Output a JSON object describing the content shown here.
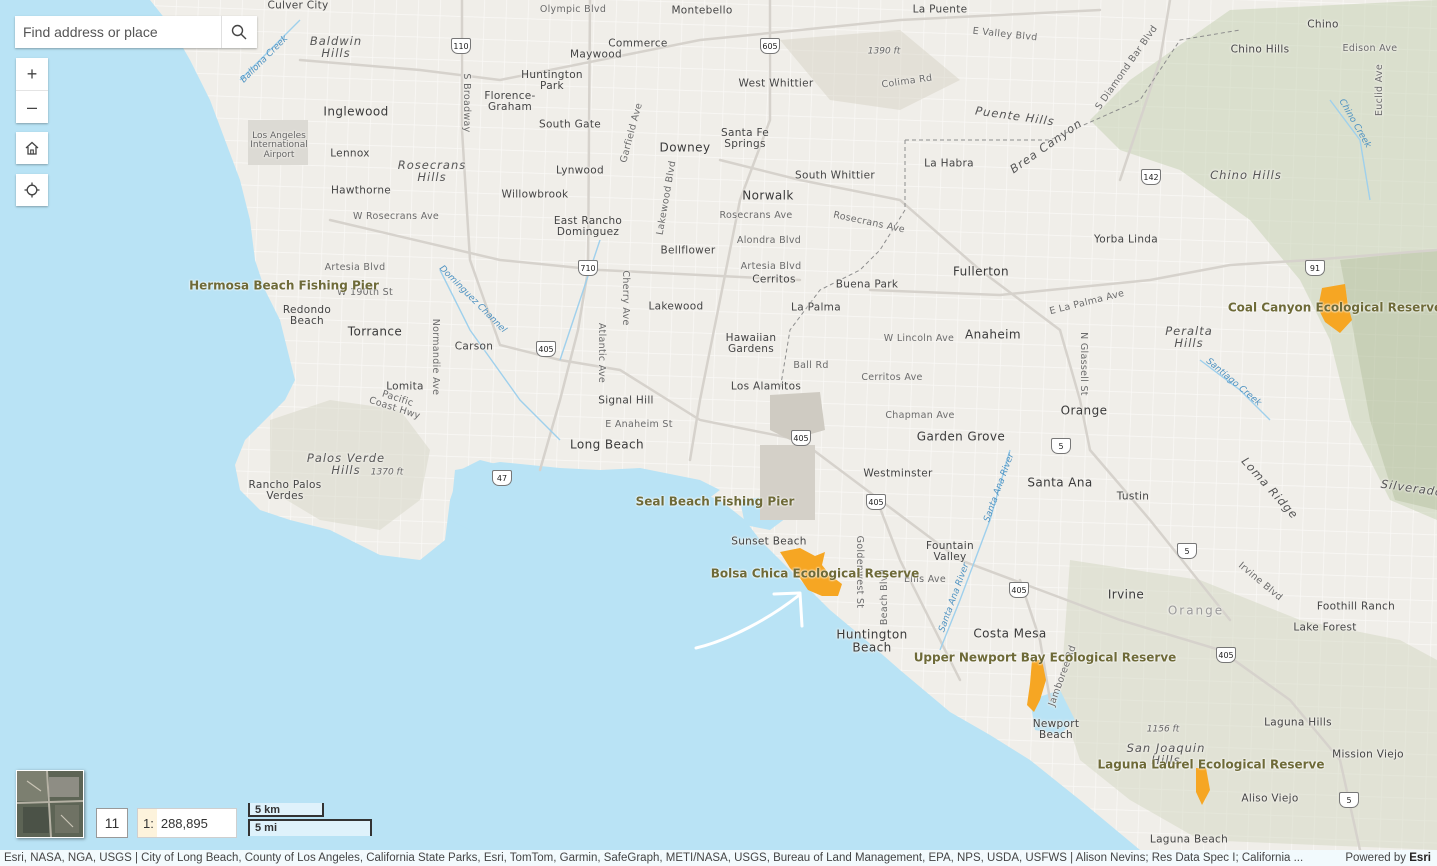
{
  "search": {
    "placeholder": "Find address or place"
  },
  "zoom": {
    "in_label": "+",
    "out_label": "–"
  },
  "zoom_level": "11",
  "scale": {
    "prefix": "1:",
    "value": "288,895"
  },
  "scalebar": {
    "metric": "5 km",
    "imperial": "5 mi"
  },
  "attribution": {
    "text": "Esri, NASA, NGA, USGS | City of Long Beach, County of Los Angeles, California State Parks, Esri, TomTom, Garmin, SafeGraph, METI/NASA, USGS, Bureau of Land Management, EPA, NPS, USDA, USFWS | Alison Nevins; Res Data Spec I; California ...",
    "powered_by": "Powered by",
    "powered_brand": "Esri"
  },
  "colors": {
    "water": "#b9e3f5",
    "land": "#f0eee9",
    "reserve": "#f6a623",
    "poi_text": "#6e6a38"
  },
  "poi": {
    "hermosa": "Hermosa Beach Fishing Pier",
    "seal": "Seal Beach Fishing Pier",
    "bolsa": "Bolsa Chica Ecological Reserve",
    "coal": "Coal Canyon Ecological Reserve",
    "newport": "Upper Newport Bay Ecological Reserve",
    "laguna": "Laguna Laurel Ecological Reserve"
  },
  "labels": {
    "culver_city": "Culver City",
    "montebello": "Montebello",
    "la_puente": "La Puente",
    "chino": "Chino",
    "baldwin_hills": "Baldwin\nHills",
    "commerce": "Commerce",
    "maywood": "Maywood",
    "chino_hills": "Chino Hills",
    "huntington_park": "Huntington\nPark",
    "west_whittier": "West Whittier",
    "inglewood": "Inglewood",
    "florence_graham": "Florence-\nGraham",
    "lax": "Los Angeles\nInternational\nAirport",
    "south_gate": "South Gate",
    "santa_fe_springs": "Santa Fe\nSprings",
    "downey": "Downey",
    "lennox": "Lennox",
    "rosecrans_hills": "Rosecrans\nHills",
    "lynwood": "Lynwood",
    "la_habra": "La Habra",
    "south_whittier": "South Whittier",
    "hawthorne": "Hawthorne",
    "willowbrook": "Willowbrook",
    "norwalk": "Norwalk",
    "chino_hills_range": "Chino Hills",
    "east_rancho": "East Rancho\nDominguez",
    "yorba_linda": "Yorba Linda",
    "bellflower": "Bellflower",
    "fullerton": "Fullerton",
    "cerritos": "Cerritos",
    "buena_park": "Buena Park",
    "redondo": "Redondo\nBeach",
    "torrance": "Torrance",
    "carson": "Carson",
    "lakewood": "Lakewood",
    "la_palma": "La Palma",
    "anaheim": "Anaheim",
    "peralta_hills": "Peralta\nHills",
    "hawaiian_gardens": "Hawaiian\nGardens",
    "lomita": "Lomita",
    "los_alamitos": "Los Alamitos",
    "signal_hill": "Signal Hill",
    "orange": "Orange",
    "long_beach": "Long Beach",
    "garden_grove": "Garden Grove",
    "palos_verde_hills": "Palos Verde\nHills",
    "westminster": "Westminster",
    "rancho_palos_verdes": "Rancho Palos\nVerdes",
    "santa_ana": "Santa Ana",
    "tustin": "Tustin",
    "silverado": "Silverado",
    "sunset_beach": "Sunset Beach",
    "fountain_valley": "Fountain\nValley",
    "irvine": "Irvine",
    "foothill_ranch": "Foothill Ranch",
    "orange_county": "Orange",
    "lake_forest": "Lake Forest",
    "huntington_beach": "Huntington\nBeach",
    "costa_mesa": "Costa Mesa",
    "newport_beach": "Newport\nBeach",
    "laguna_hills": "Laguna Hills",
    "san_joaquin_hills": "San Joaquin\nHills",
    "mission_viejo": "Mission Viejo",
    "aliso_viejo": "Aliso Viejo",
    "laguna_beach": "Laguna Beach",
    "loma_ridge": "Loma Ridge",
    "puente_hills": "Puente Hills",
    "brea_canyon": "Brea Canyon",
    "st_e_valley": "E Valley Blvd",
    "st_olympic": "Olympic Blvd",
    "st_colima": "Colima Rd",
    "st_diamond": "S Diamond Bar Blvd",
    "st_edison": "Edison Ave",
    "st_euclid": "Euclid Ave",
    "st_garfield": "Garfield Ave",
    "st_broadway": "S Broadway",
    "st_lakewood": "Lakewood Blvd",
    "st_w_rosecrans": "W Rosecrans Ave",
    "st_rosecrans": "Rosecrans Ave",
    "st_rosecrans2": "Rosecrans Ave",
    "st_alondra": "Alondra Blvd",
    "st_artesia": "Artesia Blvd",
    "st_artesia2": "Artesia Blvd",
    "st_w190": "W 190th St",
    "st_cherry": "Cherry Ave",
    "st_la_palma": "E La Palma Ave",
    "st_normandie": "Normandie Ave",
    "st_atlantic": "Atlantic Ave",
    "st_w_lincoln": "W Lincoln Ave",
    "st_ball": "Ball Rd",
    "st_cerritos": "Cerritos Ave",
    "st_pch": "Pacific\nCoast Hwy",
    "st_chapman": "Chapman Ave",
    "st_e_anaheim": "E Anaheim St",
    "st_n_glassell": "N Glassell St",
    "st_goldenwest": "Goldenwest St",
    "st_beach": "Beach Blvd",
    "st_irvine": "Irvine Blvd",
    "st_jamboree": "Jamboree Rd",
    "st_ellis": "Ellis Ave",
    "w_ballona": "Ballona Creek",
    "w_dominguez": "Dominguez Channel",
    "w_santiago": "Santiago Creek",
    "w_santa_ana_river": "Santa Ana River",
    "w_santa_ana_river2": "Santa Ana River",
    "w_chino_creek": "Chino Creek",
    "elev_1390": "1390 ft",
    "elev_1370": "1370 ft",
    "elev_1156": "1156 ft",
    "hw_110": "110",
    "hw_605": "605",
    "hw_710": "710",
    "hw_405a": "405",
    "hw_405b": "405",
    "hw_405c": "405",
    "hw_405d": "405",
    "hw_405e": "405",
    "hw_47": "47",
    "hw_5a": "5",
    "hw_5b": "5",
    "hw_5c": "5",
    "hw_142": "142",
    "hw_91": "91"
  }
}
